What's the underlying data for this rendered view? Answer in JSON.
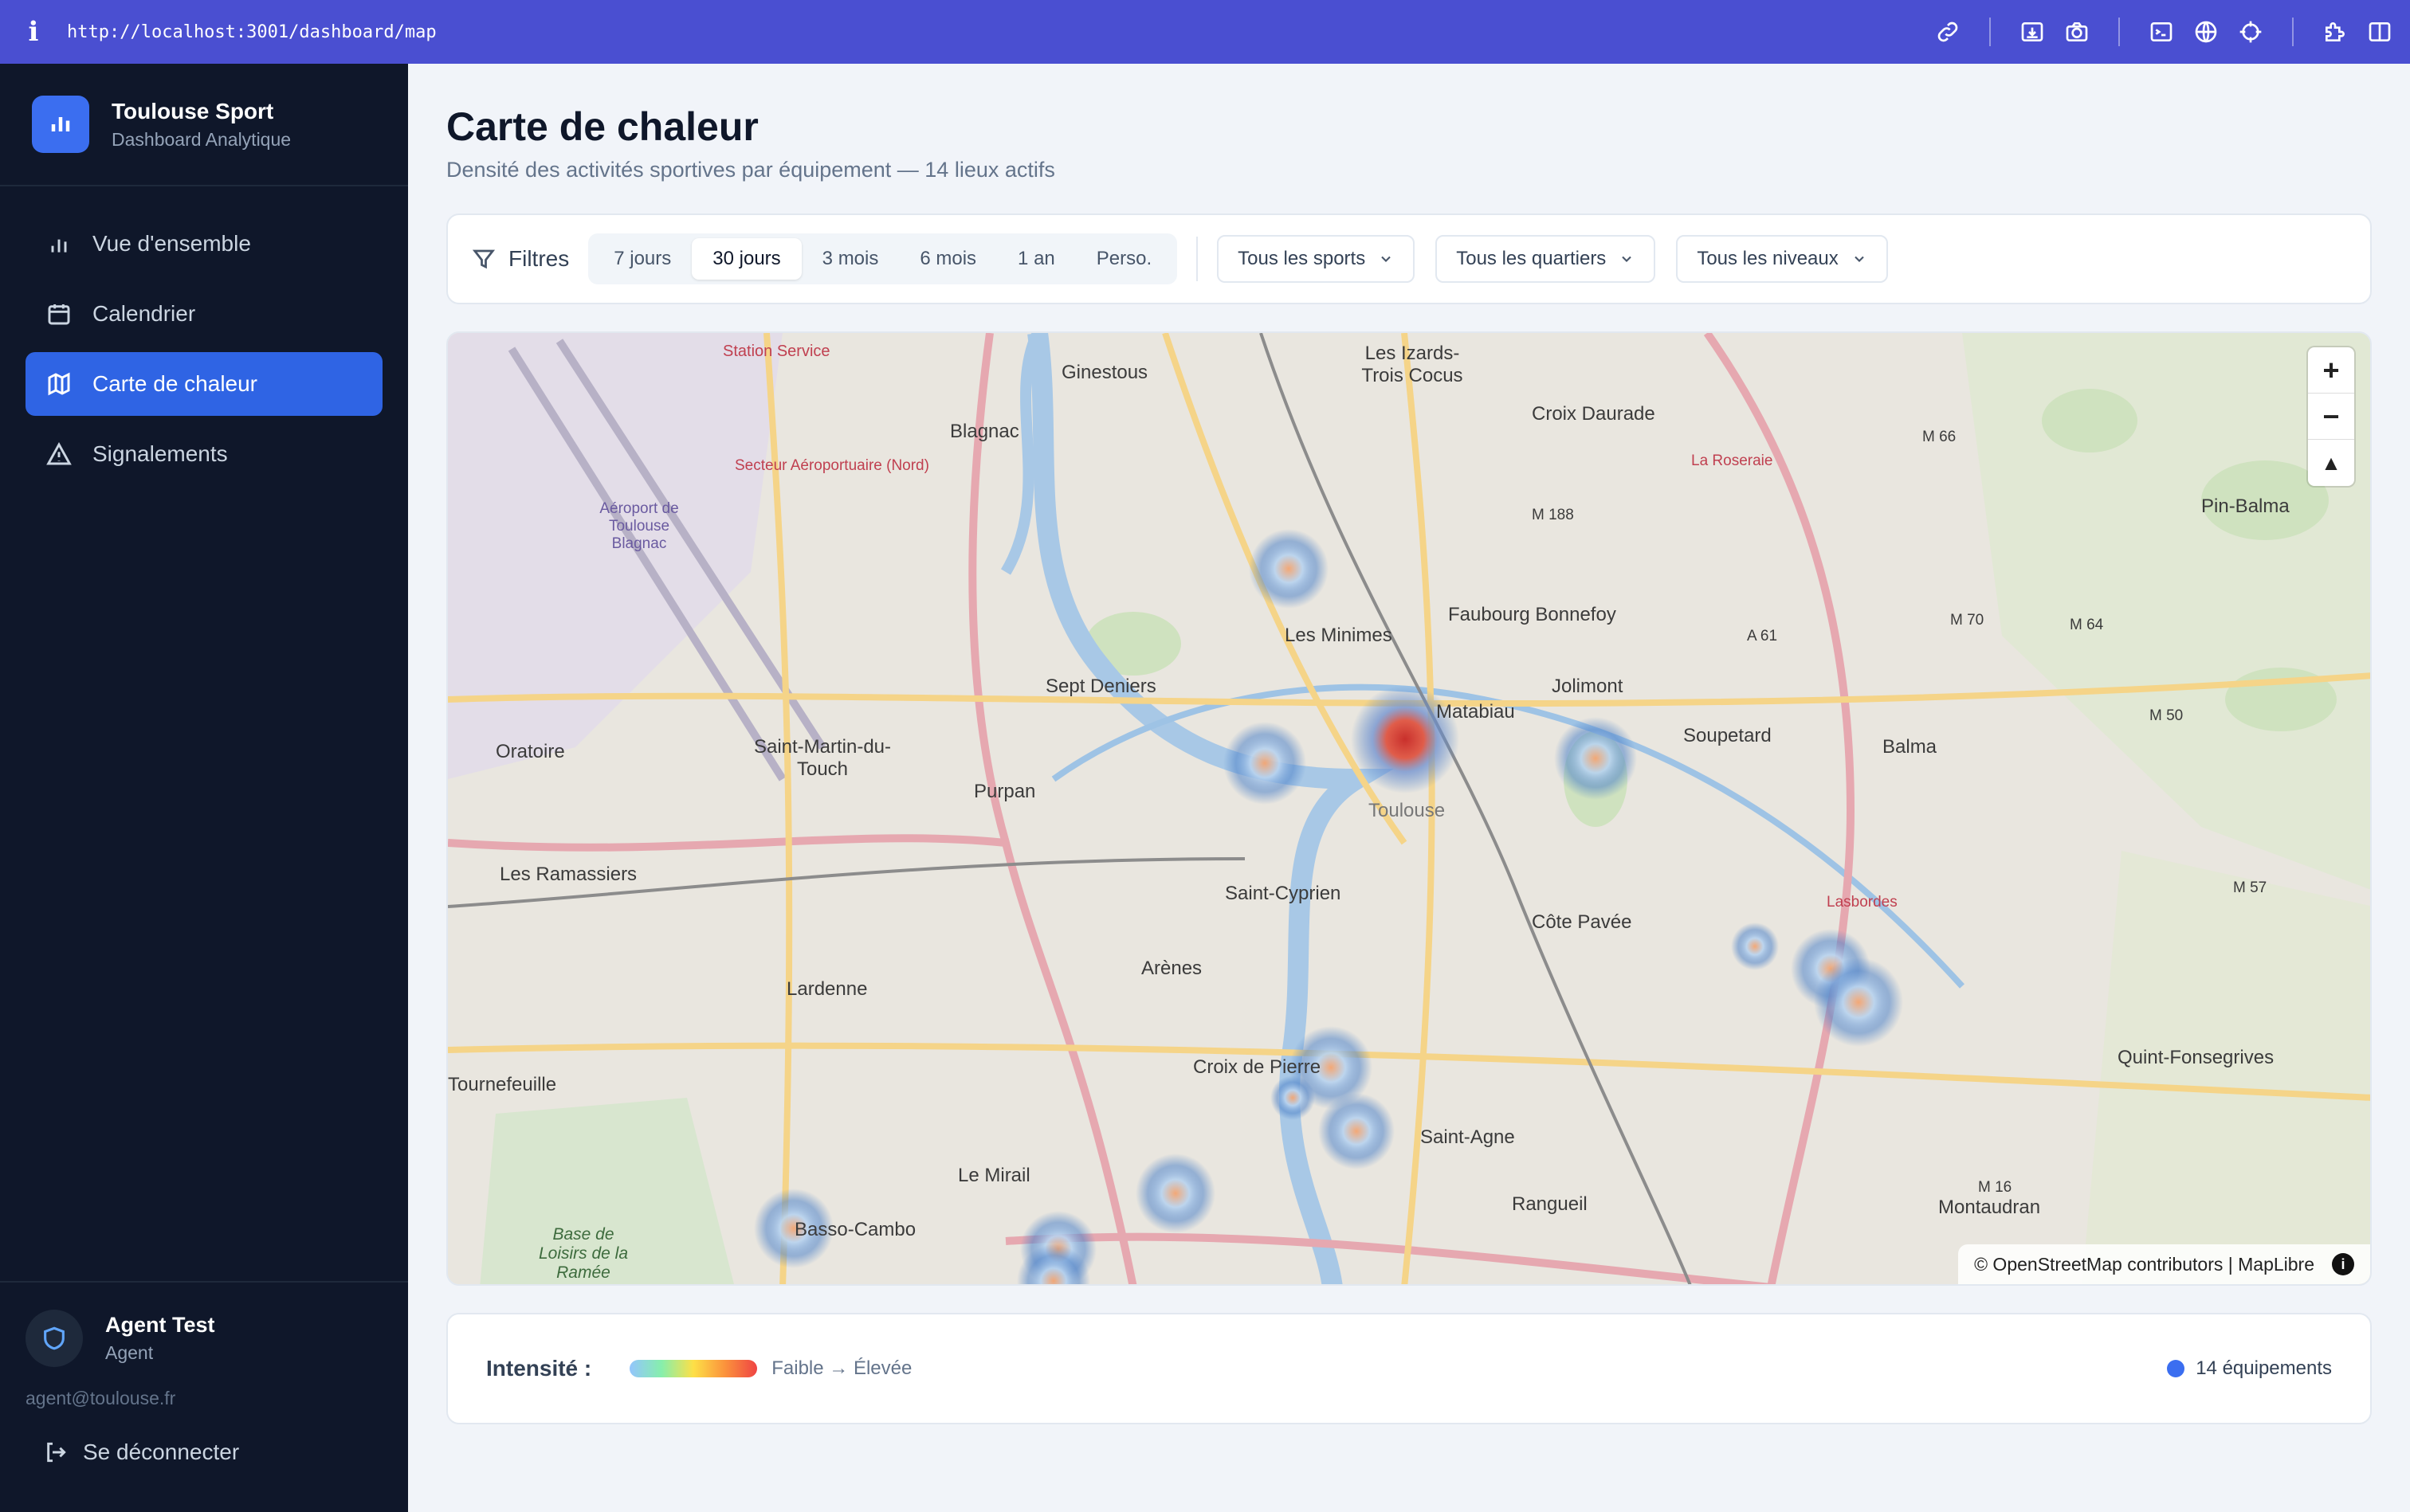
{
  "browser": {
    "url": "http://localhost:3001/dashboard/map"
  },
  "brand": {
    "title": "Toulouse Sport",
    "subtitle": "Dashboard Analytique"
  },
  "nav": [
    {
      "label": "Vue d'ensemble",
      "icon": "bar-chart-icon"
    },
    {
      "label": "Calendrier",
      "icon": "calendar-icon"
    },
    {
      "label": "Carte de chaleur",
      "icon": "map-icon",
      "active": true
    },
    {
      "label": "Signalements",
      "icon": "alert-triangle-icon"
    }
  ],
  "user": {
    "name": "Agent Test",
    "role": "Agent",
    "email": "agent@toulouse.fr",
    "logout": "Se déconnecter"
  },
  "page": {
    "title": "Carte de chaleur",
    "subtitle": "Densité des activités sportives par équipement — 14 lieux actifs"
  },
  "filters": {
    "label": "Filtres",
    "periods": [
      "7 jours",
      "30 jours",
      "3 mois",
      "6 mois",
      "1 an",
      "Perso."
    ],
    "active_period": "30 jours",
    "sport": "Tous les sports",
    "quartier": "Tous les quartiers",
    "niveau": "Tous les niveaux"
  },
  "map": {
    "attribution": "© OpenStreetMap contributors | MapLibre",
    "labels": [
      "Station Service",
      "Ginestous",
      "Les Izards-Trois Cocus",
      "Croix Daurade",
      "M 66",
      "Blagnac",
      "Secteur Aéroportuaire (Nord)",
      "La Roseraie",
      "Pin-Balma",
      "M 188",
      "Aéroport de Toulouse Blagnac",
      "Les Minimes",
      "Faubourg Bonnefoy",
      "A 61",
      "M 70",
      "M 64",
      "Sept Deniers",
      "Jolimont",
      "Matabiau",
      "Soupetard",
      "Balma",
      "M 50",
      "Oratoire",
      "Saint-Martin-du-Touch",
      "Purpan",
      "Toulouse",
      "Les Ramassiers",
      "Saint-Cyprien",
      "Côte Pavée",
      "M 57",
      "Lasbordes",
      "Lardenne",
      "Arènes",
      "Croix de Pierre",
      "Quint-Fonsegrives",
      "Tournefeuille",
      "Saint-Agne",
      "Le Mirail",
      "Rangueil",
      "M 16",
      "Montaudran",
      "Basso-Cambo",
      "Base de Loisirs de la Ramée"
    ],
    "heat_points": 14
  },
  "legend": {
    "title": "Intensité :",
    "range": "Faible → Élevée",
    "count": "14 équipements"
  },
  "colors": {
    "topbar": "#4a4fd1",
    "sidebar": "#0f172a",
    "accent": "#2f64e4"
  }
}
